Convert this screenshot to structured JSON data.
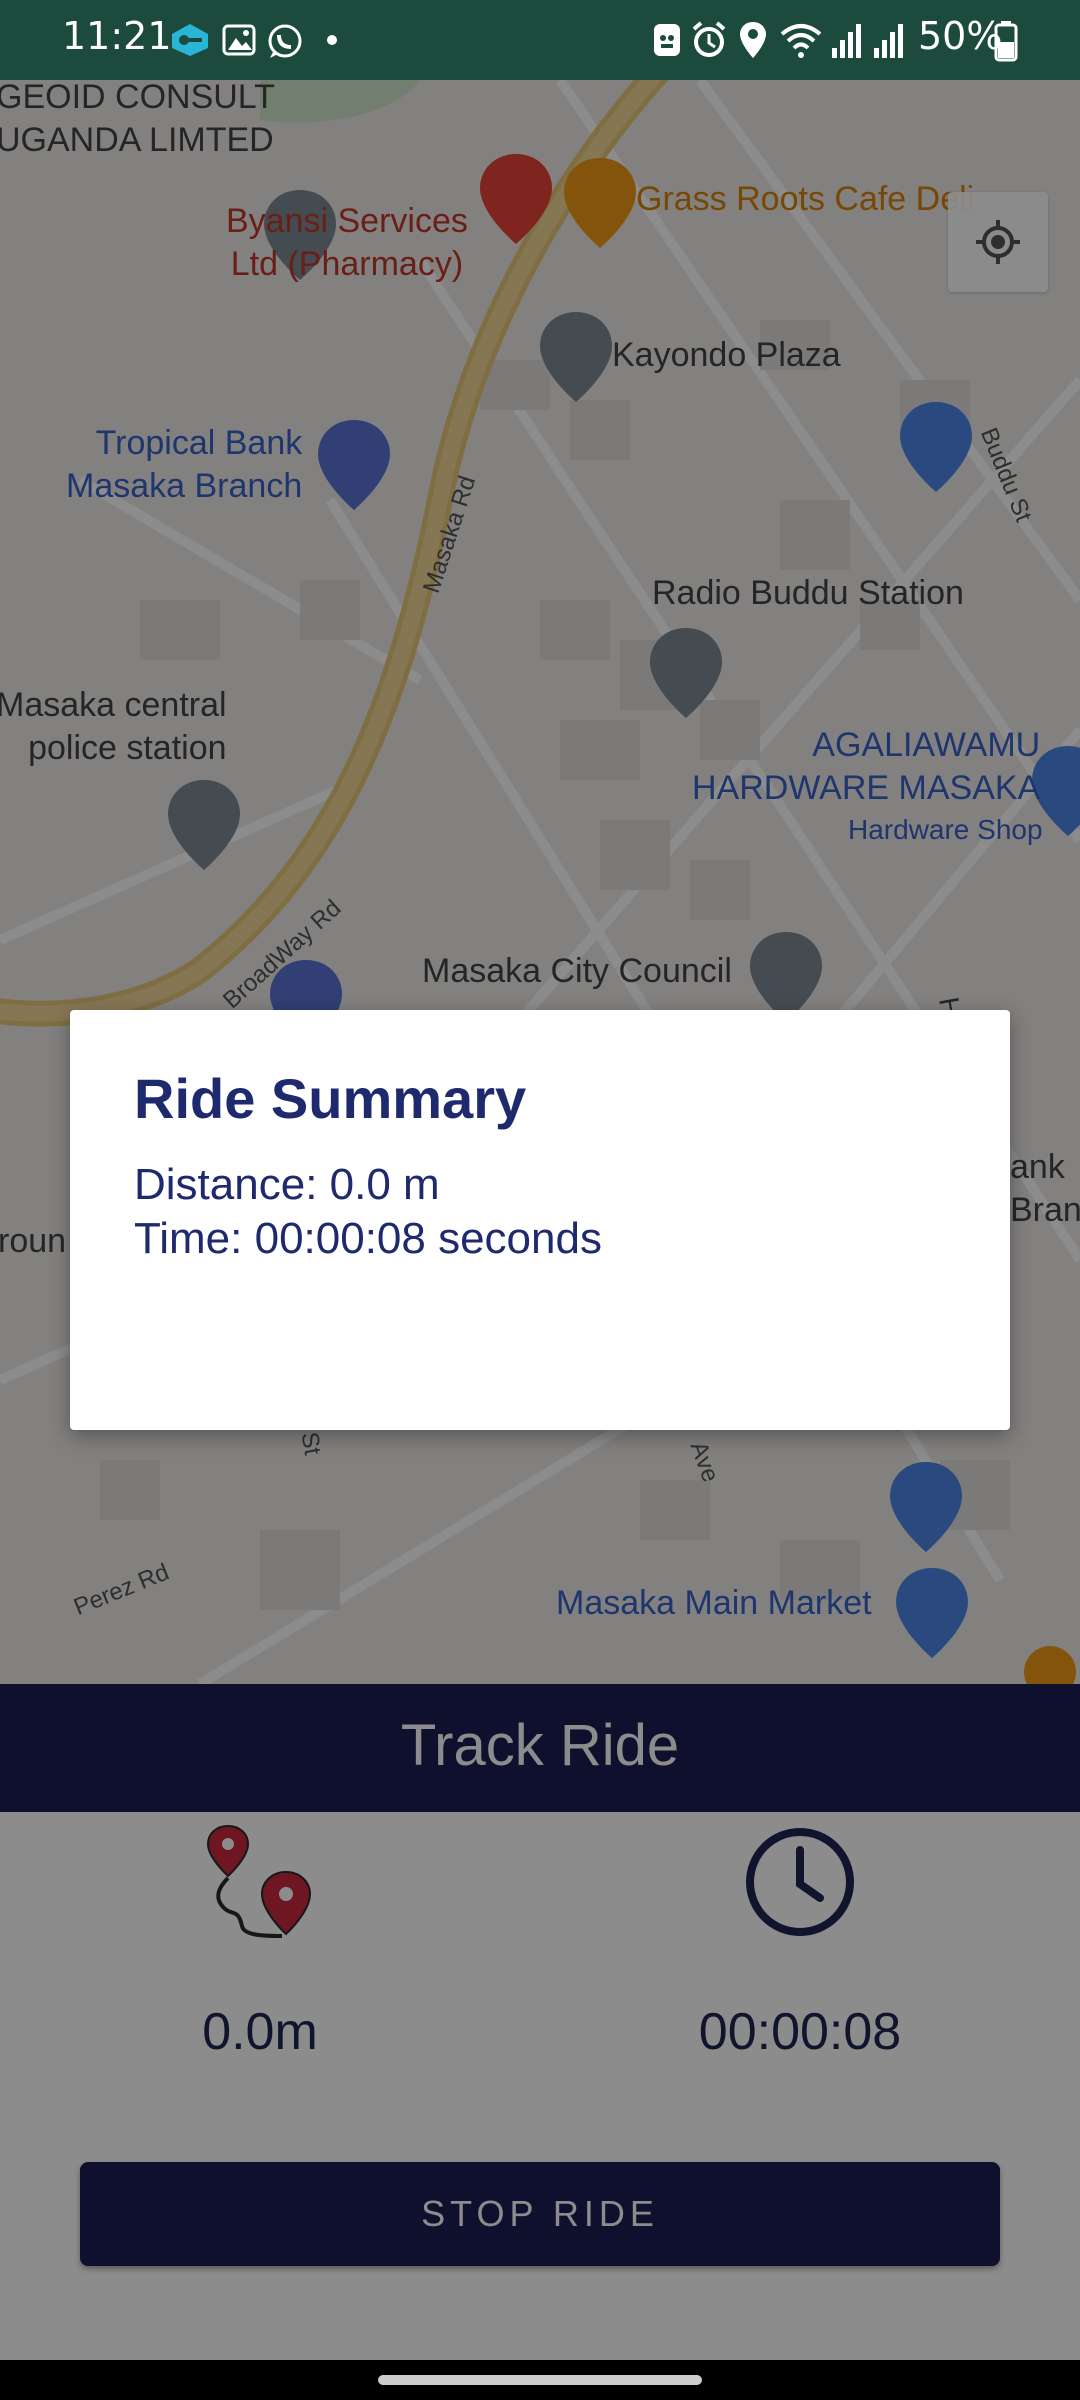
{
  "status_bar": {
    "time": "11:21",
    "battery": "50%",
    "left_icons": [
      "vpn-key-icon",
      "gallery-icon",
      "whatsapp-icon",
      "dot-icon"
    ],
    "right_icons": [
      "app-icon",
      "alarm-icon",
      "location-icon",
      "wifi-icon",
      "signal-icon",
      "signal-icon",
      "battery-icon"
    ]
  },
  "map": {
    "labels": {
      "geoid_1": "GEOID CONSULT",
      "geoid_2": "UGANDA LIMTED",
      "byansi_1": "Byansi Services",
      "byansi_2": "Ltd (Pharmacy)",
      "grass_roots": "Grass Roots Cafe Deli",
      "kayondo": "Kayondo Plaza",
      "tropical_1": "Tropical Bank",
      "tropical_2": "Masaka Branch",
      "radio": "Radio Buddu Station",
      "police_1": "Masaka central",
      "police_2": "police station",
      "agaliawamu_1": "AGALIAWAMU",
      "agaliawamu_2": "HARDWARE MASAKA",
      "hardware_shop": "Hardware Shop",
      "city_council": "Masaka City Council",
      "main_market": "Masaka Main Market",
      "bank_partial_1": "ank",
      "bank_partial_2": "Branc",
      "ground_partial": "roun",
      "h_partial": "H"
    },
    "streets": {
      "masaka_rd": "Masaka Rd",
      "broadway": "BroadWay Rd",
      "buddu": "Buddu St",
      "perez": "Perez Rd",
      "ave": "Ave",
      "st_partial": "St"
    }
  },
  "track": {
    "title": "Track Ride",
    "distance_value": "0.0m",
    "time_value": "00:00:08",
    "stop_label": "STOP RIDE"
  },
  "dialog": {
    "title": "Ride Summary",
    "distance": "Distance: 0.0 m",
    "time": "Time: 00:00:08 seconds"
  },
  "colors": {
    "primary_navy": "#1c1e55",
    "dialog_text": "#1f2a6e",
    "route_red": "#c8283c"
  }
}
